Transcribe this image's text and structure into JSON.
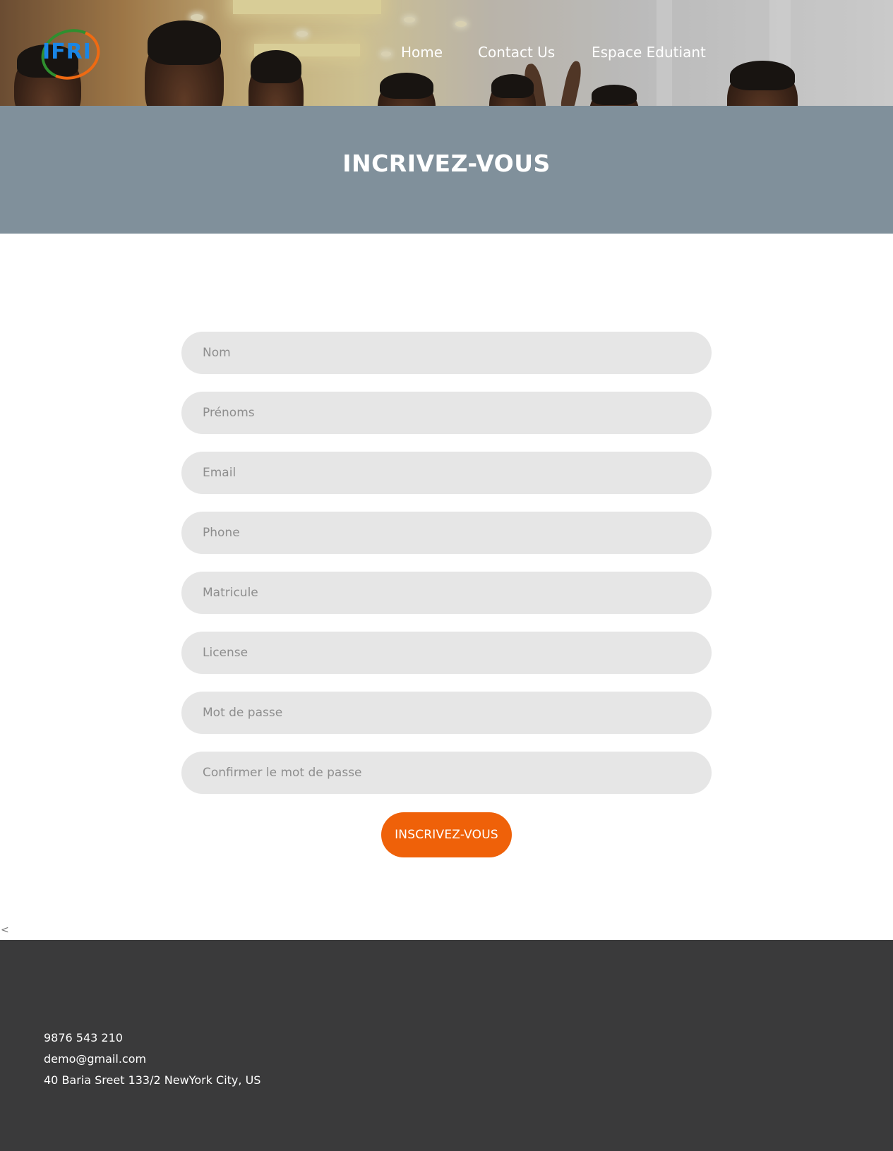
{
  "header": {
    "logo_text": "IFRI",
    "nav": [
      {
        "label": "Home"
      },
      {
        "label": "Contact Us"
      },
      {
        "label": "Espace Edutiant"
      }
    ]
  },
  "title_band": {
    "title": "INCRIVEZ-VOUS",
    "color": "#80909b"
  },
  "form": {
    "fields": [
      {
        "placeholder": "Nom",
        "value": ""
      },
      {
        "placeholder": "Prénoms",
        "value": ""
      },
      {
        "placeholder": "Email",
        "value": ""
      },
      {
        "placeholder": "Phone",
        "value": ""
      },
      {
        "placeholder": "Matricule",
        "value": ""
      },
      {
        "placeholder": "License",
        "value": ""
      },
      {
        "placeholder": "Mot de passe",
        "value": ""
      },
      {
        "placeholder": "Confirmer le mot de passe",
        "value": ""
      }
    ],
    "submit_label": "INSCRIVEZ-VOUS",
    "submit_color": "#ef6109"
  },
  "carousel": {
    "prev_label": "<"
  },
  "footer": {
    "phone": "9876 543 210",
    "email": "demo@gmail.com",
    "address": "40 Baria Sreet 133/2 NewYork City, US",
    "background": "#3a3a3b"
  }
}
